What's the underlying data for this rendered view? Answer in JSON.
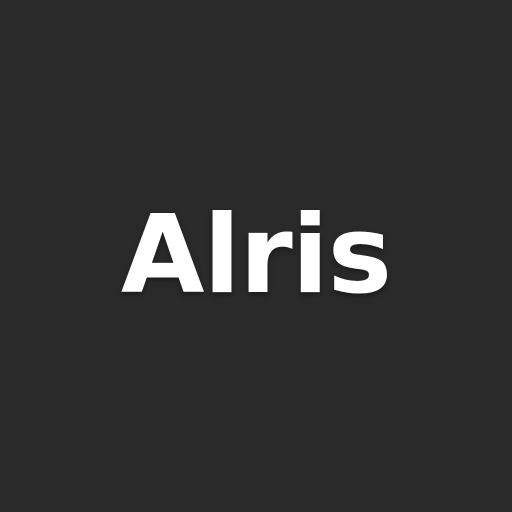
{
  "logo": {
    "text": "Alris",
    "text_color": "#ffffff",
    "background_color": "#2a2a2a"
  }
}
